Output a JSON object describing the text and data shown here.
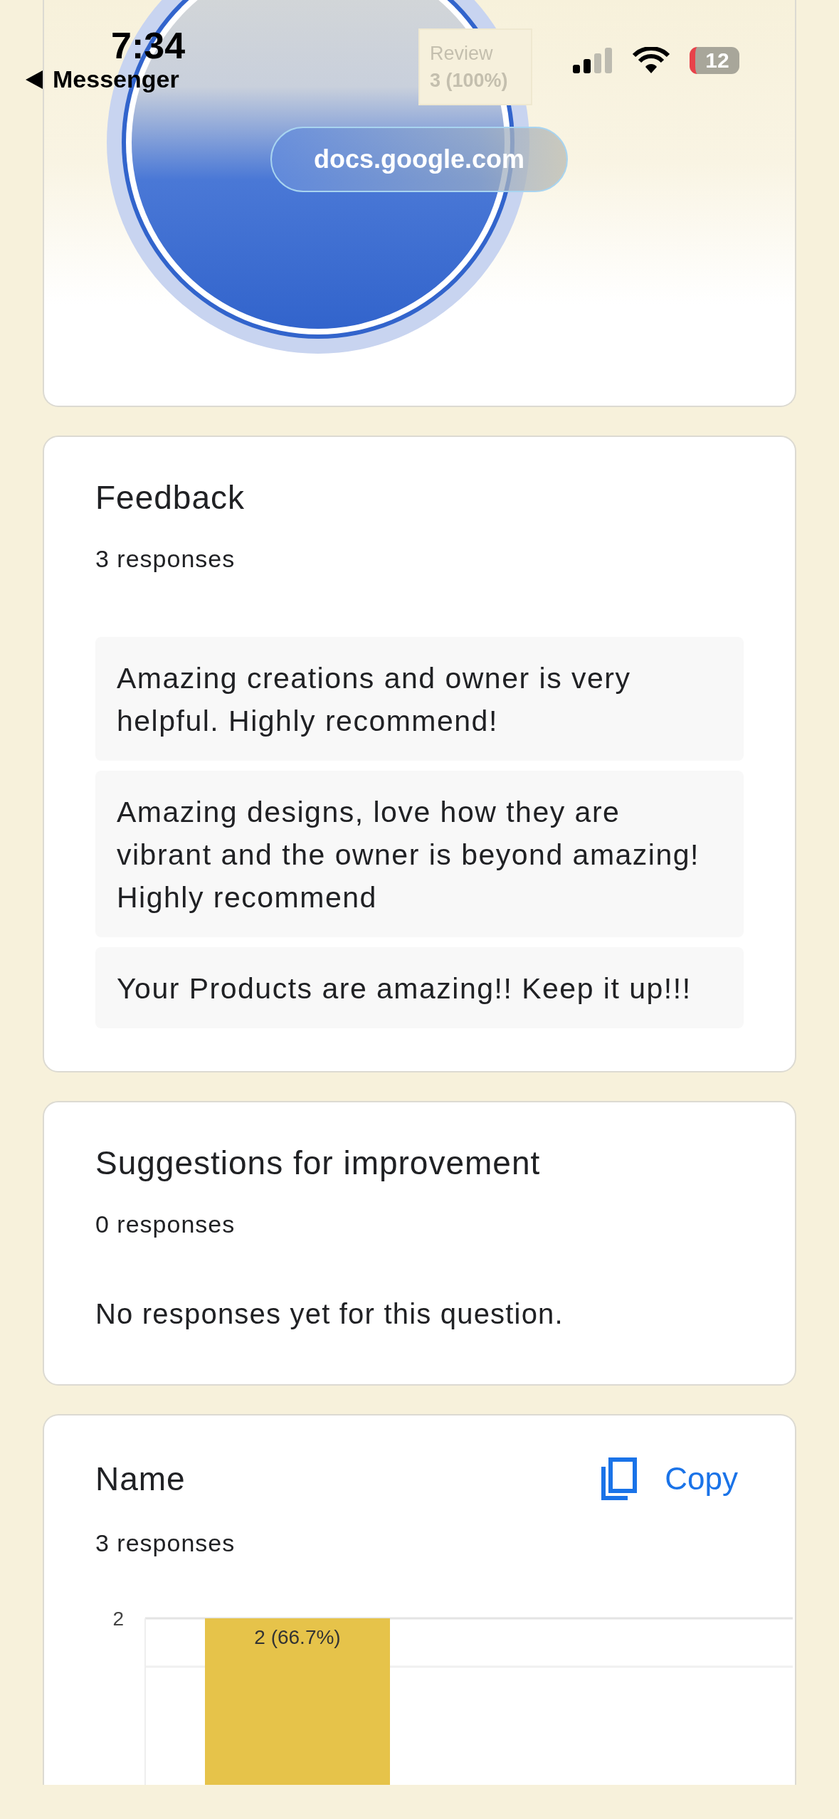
{
  "status_bar": {
    "time": "7:34",
    "back_label": "Messenger",
    "battery": "12"
  },
  "address_pill": {
    "text": "docs.google.com"
  },
  "pie_card": {
    "tooltip": {
      "label": "Review",
      "value": "3 (100%)"
    }
  },
  "feedback": {
    "title": "Feedback",
    "count": "3 responses",
    "responses": [
      "Amazing creations and owner is very helpful. Highly recommend!",
      "Amazing designs, love how they are vibrant and the owner is beyond amazing! Highly recommend",
      "Your Products are amazing!! Keep it up!!!"
    ]
  },
  "suggestions": {
    "title": "Suggestions for improvement",
    "count": "0 responses",
    "empty_text": "No responses yet for this question."
  },
  "name_question": {
    "title": "Name",
    "count": "3 responses",
    "copy_label": "Copy",
    "bar_chart": {
      "axis_tick": "2",
      "bar_label": "2 (66.7%)"
    }
  }
}
